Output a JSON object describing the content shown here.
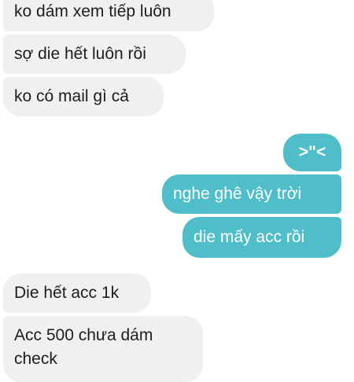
{
  "chat": {
    "messages": [
      {
        "sender": "other",
        "text": "ko dám xem tiếp luôn"
      },
      {
        "sender": "other",
        "text": "sợ die hết luôn rồi"
      },
      {
        "sender": "other",
        "text": "ko có mail gì cả"
      },
      {
        "sender": "me",
        "text": ">\"<"
      },
      {
        "sender": "me",
        "text": "nghe ghê vậy trời"
      },
      {
        "sender": "me",
        "text": "die mấy acc rồi"
      },
      {
        "sender": "other",
        "text": "Die hết acc 1k"
      },
      {
        "sender": "other",
        "text": "Acc 500 chưa dám check"
      }
    ]
  },
  "colors": {
    "incoming_bubble": "#f1f0f0",
    "outgoing_bubble": "#4fbec9",
    "incoming_text": "#1d1d1d",
    "outgoing_text": "#ffffff"
  }
}
